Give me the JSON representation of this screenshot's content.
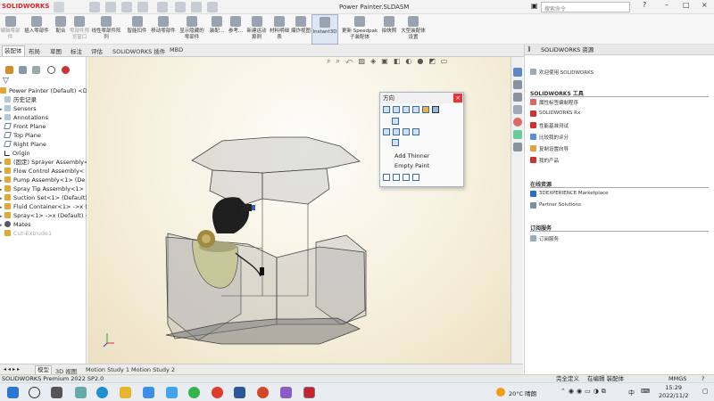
{
  "app": {
    "logo": "SOLIDWORKS",
    "doc_title": "Power Painter.SLDASM",
    "search_placeholder": "搜索命令"
  },
  "ribbon": [
    {
      "label": "编辑零部件",
      "dim": true
    },
    {
      "label": "插入零部件",
      "dim": false
    },
    {
      "label": "配合",
      "dim": false
    },
    {
      "label": "零部件预览窗口",
      "dim": true
    },
    {
      "label": "线性零部件阵列",
      "dim": false
    },
    {
      "label": "智能扣件",
      "dim": false
    },
    {
      "label": "移动零部件",
      "dim": false
    },
    {
      "label": "显示隐藏的零部件",
      "dim": false
    },
    {
      "label": "装配...",
      "dim": false
    },
    {
      "label": "参考...",
      "dim": false
    },
    {
      "label": "新建运动算例",
      "dim": false
    },
    {
      "label": "材料明细表",
      "dim": false
    },
    {
      "label": "爆炸视图",
      "dim": false
    },
    {
      "label": "Instant3D",
      "dim": false,
      "selected": true
    },
    {
      "label": "更新 Speedpak 子装配体",
      "dim": false
    },
    {
      "label": "拍快照",
      "dim": false
    },
    {
      "label": "大型装配体设置",
      "dim": false
    }
  ],
  "command_tabs": [
    "装配体",
    "布局",
    "草图",
    "标注",
    "评估",
    "SOLIDWORKS 插件",
    "MBD"
  ],
  "tree": {
    "root": "Power Painter (Default) <De",
    "items": [
      {
        "label": "历史记录",
        "icon": "history",
        "dim": false
      },
      {
        "label": "Sensors",
        "icon": "sensor",
        "dim": false
      },
      {
        "label": "Annotations",
        "icon": "annotation",
        "dim": false
      },
      {
        "label": "Front Plane",
        "icon": "plane",
        "dim": false
      },
      {
        "label": "Top Plane",
        "icon": "plane",
        "dim": false
      },
      {
        "label": "Right Plane",
        "icon": "plane",
        "dim": false
      },
      {
        "label": "Origin",
        "icon": "origin",
        "dim": false
      },
      {
        "label": "(固定) Sprayer Assembly<",
        "icon": "assembly",
        "dim": false
      },
      {
        "label": "Flow Control Assembly<",
        "icon": "assembly",
        "dim": false
      },
      {
        "label": "Pump Assembly<1> (De",
        "icon": "assembly",
        "dim": false
      },
      {
        "label": "Spray Tip Assembly<1>",
        "icon": "assembly",
        "dim": false
      },
      {
        "label": "Suction Set<1> (Default)",
        "icon": "assembly",
        "dim": false
      },
      {
        "label": "Fluid Container<1> ->x (",
        "icon": "assembly",
        "dim": false
      },
      {
        "label": "Spray<1> ->x (Default) <",
        "icon": "assembly",
        "dim": false
      },
      {
        "label": "Mates",
        "icon": "mates",
        "dim": false
      },
      {
        "label": "Cut-Extrude1",
        "icon": "cut",
        "dim": true
      }
    ]
  },
  "orientation": {
    "title": "方向",
    "close": "×",
    "menu": [
      "Add Thinner",
      "Empty Paint"
    ]
  },
  "resources": {
    "header": "SOLIDWORKS 资源",
    "welcome": "欢迎使用 SOLIDWORKS",
    "tools_title": "SOLIDWORKS 工具",
    "tools": [
      "属性标签编制程序",
      "SOLIDWORKS Rx",
      "性能基准测试",
      "比较我的评分",
      "复制设置向导",
      "我的产品"
    ],
    "online_title": "在线资源",
    "online": [
      "3DEXPERIENCE Marketplace",
      "Partner Solutions"
    ],
    "sub_title": "订阅服务",
    "sub": [
      "订阅服务"
    ]
  },
  "bottom_tabs": [
    "模型",
    "3D 视图",
    "Motion Study 1",
    "Motion Study 2"
  ],
  "status": {
    "left": "SOLIDWORKS Premium 2022 SP2.0",
    "mid1": "完全定义",
    "mid2": "在编辑 装配体",
    "units": "MMGS"
  },
  "taskbar": {
    "weather": "20°C 晴朗",
    "time": "15:29",
    "date": "2022/11/2",
    "ime": "中",
    "bell": "☐"
  }
}
